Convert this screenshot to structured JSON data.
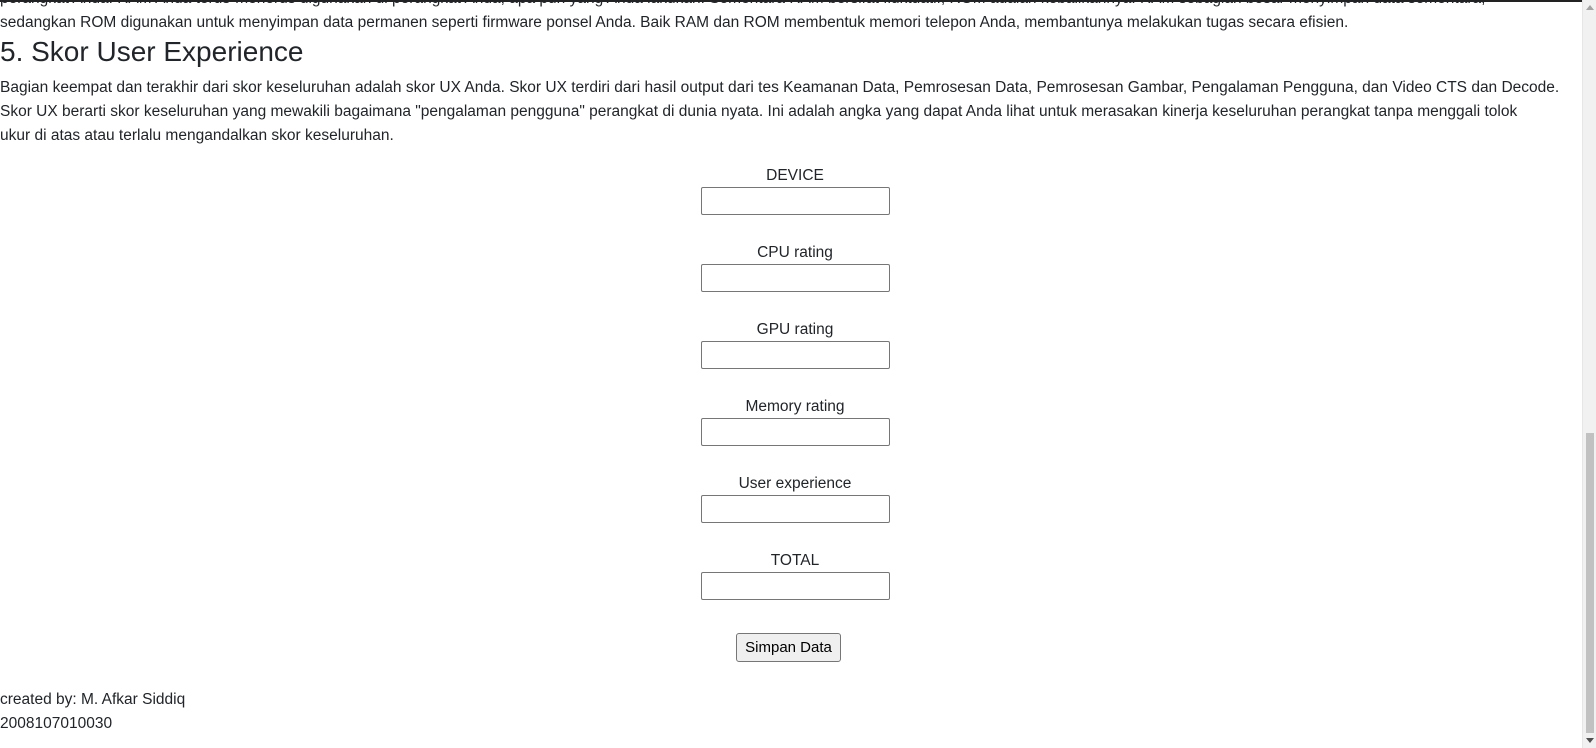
{
  "article": {
    "cut_line": "perangkat Anda. RAM Anda terus-menerus digunakan di perangkat Anda, apa pun yang Anda lakukan. Sementara RAM bersifat fluktuatif, ROM adalah kebalikannya. RAM sebagian besar menyimpan data sementara,",
    "rom_line": "sedangkan ROM digunakan untuk menyimpan data permanen seperti firmware ponsel Anda. Baik RAM dan ROM membentuk memori telepon Anda, membantunya melakukan tugas secara efisien.",
    "section_title": "5. Skor User Experience",
    "ux_lines": [
      "Bagian keempat dan terakhir dari skor keseluruhan adalah skor UX Anda. Skor UX terdiri dari hasil output dari tes Keamanan Data, Pemrosesan Data, Pemrosesan Gambar, Pengalaman Pengguna, dan Video CTS dan Decode.",
      "Skor UX berarti skor keseluruhan yang mewakili bagaimana \"pengalaman pengguna\" perangkat di dunia nyata. Ini adalah angka yang dapat Anda lihat untuk merasakan kinerja keseluruhan perangkat tanpa menggali tolok",
      "ukur di atas atau terlalu mengandalkan skor keseluruhan."
    ]
  },
  "form": {
    "fields": [
      {
        "label": "DEVICE",
        "value": ""
      },
      {
        "label": "CPU rating",
        "value": ""
      },
      {
        "label": "GPU rating",
        "value": ""
      },
      {
        "label": "Memory rating",
        "value": ""
      },
      {
        "label": "User experience",
        "value": ""
      },
      {
        "label": "TOTAL",
        "value": ""
      }
    ],
    "submit_label": "Simpan Data"
  },
  "footer": {
    "created_by": "created by: M. Afkar Siddiq",
    "student_id": "2008107010030"
  },
  "icons": {
    "scroll_up": "triangle-up-icon",
    "scroll_down": "triangle-down-icon"
  },
  "colors": {
    "text": "#212529",
    "button_bg": "#efefef",
    "input_border": "#767676"
  }
}
